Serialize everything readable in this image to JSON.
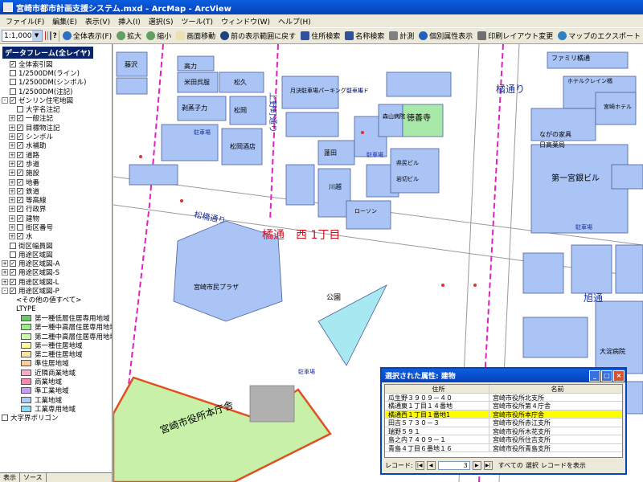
{
  "window": {
    "title": "宮崎市都市計画支援システム.mxd - ArcMap - ArcView"
  },
  "menu": [
    "ファイル(F)",
    "編集(E)",
    "表示(V)",
    "挿入(I)",
    "選択(S)",
    "ツール(T)",
    "ウィンドウ(W)",
    "ヘルプ(H)"
  ],
  "toolbar": {
    "scale": "1:1,000",
    "full_extent": "全体表示(F)",
    "zoom_in": "拡大",
    "zoom_out": "縮小",
    "pan": "画面移動",
    "prev_extent": "前の表示範囲に戻す",
    "address_search": "住所検索",
    "name_search": "名称検索",
    "measure": "計測",
    "individual_print": "個別属性表示",
    "print_layout": "印刷レイアウト変更",
    "map_export": "マップのエクスポート"
  },
  "toc": {
    "header": "データフレーム(全レイヤ)",
    "items": [
      {
        "label": "全体索引図",
        "indent": 0,
        "checked": true,
        "exp": ""
      },
      {
        "label": "1/2500DM(ライン)",
        "indent": 0,
        "checked": false,
        "exp": ""
      },
      {
        "label": "1/2500DM(シンボル)",
        "indent": 0,
        "checked": false,
        "exp": ""
      },
      {
        "label": "1/2500DM(注記)",
        "indent": 0,
        "checked": false,
        "exp": ""
      },
      {
        "label": "ゼンリン住宅地図",
        "indent": 0,
        "checked": true,
        "exp": "-"
      },
      {
        "label": "大字名注記",
        "indent": 1,
        "checked": false,
        "exp": ""
      },
      {
        "label": "一般注記",
        "indent": 1,
        "checked": true,
        "exp": "+"
      },
      {
        "label": "目標物注記",
        "indent": 1,
        "checked": true,
        "exp": "+"
      },
      {
        "label": "シンボル",
        "indent": 1,
        "checked": true,
        "exp": "+"
      },
      {
        "label": "水補助",
        "indent": 1,
        "checked": true,
        "exp": "+"
      },
      {
        "label": "道路",
        "indent": 1,
        "checked": true,
        "exp": "+"
      },
      {
        "label": "歩道",
        "indent": 1,
        "checked": true,
        "exp": "+"
      },
      {
        "label": "施設",
        "indent": 1,
        "checked": true,
        "exp": "+"
      },
      {
        "label": "地番",
        "indent": 1,
        "checked": true,
        "exp": "+"
      },
      {
        "label": "鉄道",
        "indent": 1,
        "checked": true,
        "exp": "+"
      },
      {
        "label": "等高線",
        "indent": 1,
        "checked": true,
        "exp": "+"
      },
      {
        "label": "行政界",
        "indent": 1,
        "checked": true,
        "exp": "+"
      },
      {
        "label": "建物",
        "indent": 1,
        "checked": true,
        "exp": "+"
      },
      {
        "label": "街区番号",
        "indent": 1,
        "checked": false,
        "exp": "+"
      },
      {
        "label": "水",
        "indent": 1,
        "checked": true,
        "exp": "+"
      },
      {
        "label": "街区幅員図",
        "indent": 0,
        "checked": false,
        "exp": ""
      },
      {
        "label": "用途区域図",
        "indent": 0,
        "checked": false,
        "exp": ""
      },
      {
        "label": "用途区域図-A",
        "indent": 0,
        "checked": true,
        "exp": "+"
      },
      {
        "label": "用途区域図-S",
        "indent": 0,
        "checked": true,
        "exp": "+"
      },
      {
        "label": "用途区域図-L",
        "indent": 0,
        "checked": true,
        "exp": "+"
      },
      {
        "label": "用途区域図-P",
        "indent": 0,
        "checked": true,
        "exp": "-"
      },
      {
        "label": "<その他の値すべて>",
        "indent": 2,
        "checked": null,
        "exp": ""
      },
      {
        "label": "LTYPE",
        "indent": 2,
        "checked": null,
        "exp": ""
      }
    ],
    "legend": [
      {
        "label": "第一種低層住居専用地域",
        "color": "#66cc66"
      },
      {
        "label": "第一種中高層住居専用地域",
        "color": "#99ee88"
      },
      {
        "label": "第二種中高層住居専用地域",
        "color": "#ccffaa"
      },
      {
        "label": "第一種住居地域",
        "color": "#ffff99"
      },
      {
        "label": "第二種住居地域",
        "color": "#ffe0a0"
      },
      {
        "label": "準住居地域",
        "color": "#ffcc99"
      },
      {
        "label": "近隣商業地域",
        "color": "#ffaacc"
      },
      {
        "label": "商業地域",
        "color": "#ff88aa"
      },
      {
        "label": "準工業地域",
        "color": "#cc99ff"
      },
      {
        "label": "工業地域",
        "color": "#aaccff"
      },
      {
        "label": "工業専用地域",
        "color": "#88ddff"
      }
    ],
    "last_item": "大字界ポリゴン",
    "tabs": [
      "表示",
      "ソース"
    ]
  },
  "map": {
    "area_label": "橘通　西 1丁目",
    "streets": [
      "松橋通り",
      "橘通り",
      "上野町通り",
      "旭通"
    ],
    "buildings": [
      "宮崎市民プラザ",
      "宮崎市役所本庁舎",
      "第一宮銀ビル",
      "徳善寺",
      "大淀病院",
      "公園",
      "高力",
      "米田呉服",
      "松久",
      "剥蒸子力",
      "松岡",
      "松岡酒店",
      "蓬田",
      "川越",
      "ながの家具",
      "日高薬局",
      "ホテルクレイン橘",
      "宮崎ホテル",
      "森山病院",
      "県民ビル",
      "岩切ビル",
      "月決駐車場パーキングゴールド",
      "藤沢",
      "ファミリ橘通",
      "ローソン"
    ],
    "labels_small": [
      "駐車場",
      "駐車場",
      "駐車場",
      "駐車場",
      "駐車場"
    ]
  },
  "attr_window": {
    "title": "選択された属性: 建物",
    "headers": [
      "住所",
      "名前"
    ],
    "rows": [
      {
        "address": "瓜生野３９０９－４０",
        "name": "宮崎市役所北支所",
        "selected": false
      },
      {
        "address": "橘通東１丁目１４番地",
        "name": "宮崎市役所第４庁舎",
        "selected": false
      },
      {
        "address": "橘通西１丁目１番地1",
        "name": "宮崎市役所本庁舎",
        "selected": true
      },
      {
        "address": "田吉５７３０－３",
        "name": "宮崎市役所赤江支所",
        "selected": false
      },
      {
        "address": "瑞野５９１",
        "name": "宮崎市役所木花支所",
        "selected": false
      },
      {
        "address": "島之内７４０９－１",
        "name": "宮崎市役所住吉支所",
        "selected": false
      },
      {
        "address": "青島４丁目６番地１６",
        "name": "宮崎市役所青島支所",
        "selected": false
      }
    ],
    "footer": {
      "record_label": "レコード:",
      "record_value": "3",
      "show_all": "すべての",
      "selection": "選択",
      "records": "レコードを表示"
    }
  },
  "colors": {
    "building": "#a9c4f5",
    "building_stroke": "#4a5fa0",
    "road": "#ffffff",
    "admin_line": "#e020c0",
    "label_red": "#d01020",
    "label_blue": "#1a2fa0",
    "zone_green": "#c8f0a8",
    "zone_stroke": "#e05020"
  }
}
